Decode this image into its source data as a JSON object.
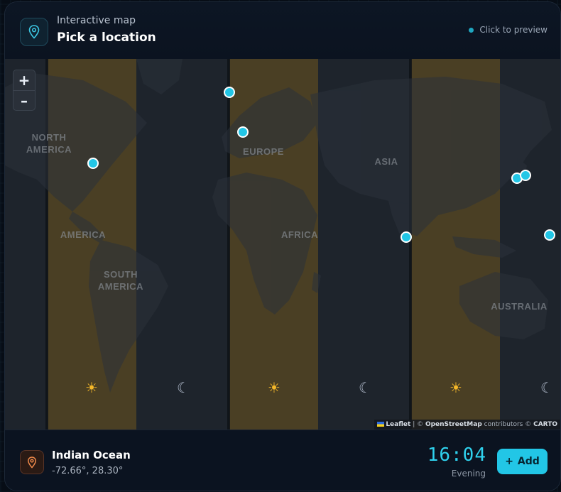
{
  "header": {
    "eyebrow": "Interactive map",
    "title": "Pick a location",
    "hint": "Click to preview"
  },
  "map": {
    "zoom_in": "+",
    "zoom_out": "–",
    "labels": {
      "north_america": [
        "NORTH",
        "AMERICA"
      ],
      "america": "AMERICA",
      "south_america": [
        "SOUTH",
        "AMERICA"
      ],
      "europe": "EUROPE",
      "africa": "AFRICA",
      "asia": "ASIA",
      "australia": "AUSTRALIA"
    },
    "day_icon": "☀",
    "night_icon": "☾",
    "attribution": {
      "leaflet": "Leaflet",
      "osm": "OpenStreetMap",
      "contributors": "contributors ©",
      "carto": "CARTO"
    }
  },
  "selected": {
    "name": "Indian Ocean",
    "coords": "-72.66°, 28.30°",
    "time": "16:04",
    "period": "Evening"
  },
  "actions": {
    "add_label": "Add"
  },
  "colors": {
    "accent": "#22c6e6",
    "day_band": "#4a3f24",
    "map_bg": "#1a1f26"
  }
}
